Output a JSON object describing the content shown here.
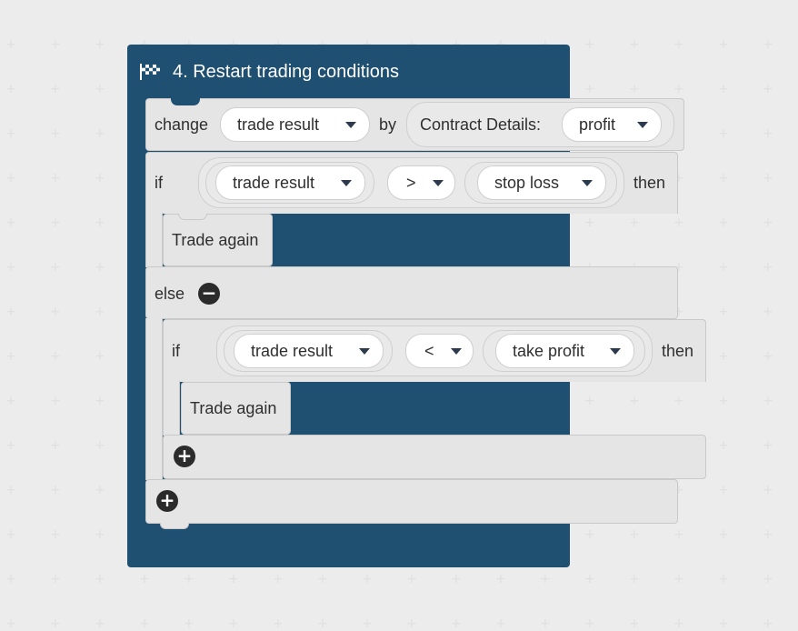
{
  "root_block": {
    "title": "4. Restart trading conditions",
    "icon": "checkered-flag-icon"
  },
  "change_block": {
    "keyword_change": "change",
    "variable": "trade result",
    "keyword_by": "by",
    "contract_details": {
      "label": "Contract Details:",
      "field": "profit"
    }
  },
  "if_block": {
    "keyword_if": "if",
    "left": "trade result",
    "operator": ">",
    "right": "stop loss",
    "keyword_then": "then",
    "action": "Trade again",
    "keyword_else": "else"
  },
  "inner_if_block": {
    "keyword_if": "if",
    "left": "trade result",
    "operator": "<",
    "right": "take profit",
    "keyword_then": "then",
    "action": "Trade again"
  },
  "icons": {
    "remove": "minus-circle-icon",
    "add": "plus-circle-icon"
  },
  "colors": {
    "root_block": "#1f4f71",
    "statement_block": "#e5e5e5",
    "field": "#ffffff"
  }
}
